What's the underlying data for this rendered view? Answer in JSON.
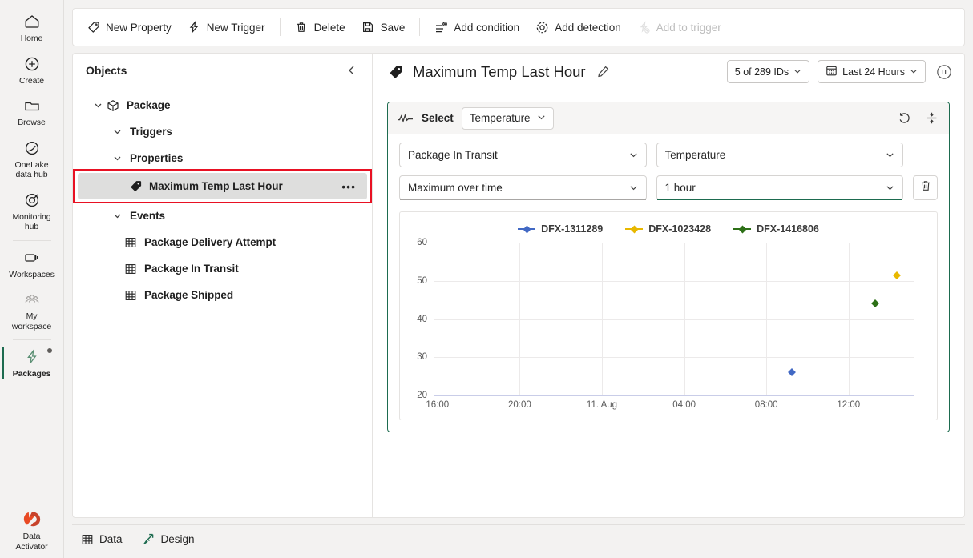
{
  "rail": {
    "items": [
      {
        "label": "Home",
        "icon": "home-icon"
      },
      {
        "label": "Create",
        "icon": "plus-circle-icon"
      },
      {
        "label": "Browse",
        "icon": "folder-icon"
      },
      {
        "label": "OneLake\ndata hub",
        "icon": "onelake-icon"
      },
      {
        "label": "Monitoring\nhub",
        "icon": "monitoring-icon"
      },
      {
        "label": "Workspaces",
        "icon": "workspaces-icon"
      },
      {
        "label": "My\nworkspace",
        "icon": "people-icon"
      },
      {
        "label": "Packages",
        "icon": "activator-bolt-icon"
      }
    ],
    "bottom": {
      "label": "Data\nActivator",
      "icon": "data-activator-logo"
    },
    "accent": "#1d6b4f"
  },
  "toolbar": {
    "items": [
      {
        "label": "New Property",
        "icon": "tag-outline-icon",
        "disabled": false
      },
      {
        "label": "New Trigger",
        "icon": "bolt-outline-icon",
        "disabled": false
      },
      {
        "label": "Delete",
        "icon": "trash-icon",
        "disabled": false
      },
      {
        "label": "Save",
        "icon": "save-icon",
        "disabled": false
      },
      {
        "label": "Add condition",
        "icon": "add-condition-icon",
        "disabled": false
      },
      {
        "label": "Add detection",
        "icon": "add-detection-icon",
        "disabled": false
      },
      {
        "label": "Add to trigger",
        "icon": "add-to-trigger-icon",
        "disabled": true
      }
    ]
  },
  "objects": {
    "title": "Objects",
    "collapse_icon": "chevron-left-icon",
    "tree": [
      {
        "label": "Package",
        "icon": "package-cube-icon",
        "indent": 0,
        "chevron": true,
        "selected": false,
        "highlighted": false
      },
      {
        "label": "Triggers",
        "icon": "",
        "indent": 1,
        "chevron": true,
        "selected": false,
        "highlighted": false
      },
      {
        "label": "Properties",
        "icon": "",
        "indent": 1,
        "chevron": true,
        "selected": false,
        "highlighted": false
      },
      {
        "label": "Maximum Temp Last Hour",
        "icon": "tag-filled-icon",
        "indent": 2,
        "chevron": false,
        "selected": true,
        "highlighted": true,
        "overflow": "•••"
      },
      {
        "label": "Events",
        "icon": "",
        "indent": 1,
        "chevron": true,
        "selected": false,
        "highlighted": false
      },
      {
        "label": "Package Delivery Attempt",
        "icon": "table-icon",
        "indent": 2,
        "chevron": false,
        "selected": false,
        "highlighted": false
      },
      {
        "label": "Package In Transit",
        "icon": "table-icon",
        "indent": 2,
        "chevron": false,
        "selected": false,
        "highlighted": false
      },
      {
        "label": "Package Shipped",
        "icon": "table-icon",
        "indent": 2,
        "chevron": false,
        "selected": false,
        "highlighted": false
      }
    ],
    "highlight_color": "#e81123"
  },
  "detail": {
    "icon": "tag-filled-icon",
    "title": "Maximum Temp Last Hour",
    "edit_icon": "pencil-icon",
    "ids_pill": {
      "label": "5 of 289 IDs",
      "chevron": "chevron-down-icon"
    },
    "time_pill": {
      "label": "Last 24 Hours",
      "icon": "calendar-icon",
      "chevron": "chevron-down-icon"
    },
    "pause_icon": "pause-circle-icon"
  },
  "query": {
    "spark_icon": "sparkline-icon",
    "select_label": "Select",
    "select_value": "Temperature",
    "refresh_icon": "undo-arrow-icon",
    "collapse_icon": "collapse-vertical-icon",
    "fields": [
      {
        "value": "Package In Transit",
        "underline": "none"
      },
      {
        "value": "Temperature",
        "underline": "none"
      },
      {
        "value": "Maximum over time",
        "underline": "grey"
      },
      {
        "value": "1 hour",
        "underline": "green"
      }
    ],
    "delete_icon": "trash-icon"
  },
  "chart_data": {
    "type": "scatter",
    "title": "",
    "xlabel": "",
    "ylabel": "",
    "ylim": [
      20,
      60
    ],
    "yticks": [
      20,
      30,
      40,
      50,
      60
    ],
    "xticks": [
      "16:00",
      "20:00",
      "11. Aug",
      "04:00",
      "08:00",
      "12:00"
    ],
    "grid": true,
    "legend_position": "top-center",
    "series": [
      {
        "name": "DFX-1311289",
        "color": "#4269c4",
        "points": [
          {
            "x": "10:00",
            "x_frac": 0.745,
            "y": 26
          }
        ]
      },
      {
        "name": "DFX-1023428",
        "color": "#e8b800",
        "points": [
          {
            "x": "13:45",
            "x_frac": 0.963,
            "y": 51.5
          }
        ]
      },
      {
        "name": "DFX-1416806",
        "color": "#2d7017",
        "points": [
          {
            "x": "12:45",
            "x_frac": 0.918,
            "y": 44
          }
        ]
      }
    ]
  },
  "bottombar": {
    "items": [
      {
        "label": "Data",
        "icon": "table-icon",
        "color": "#242424"
      },
      {
        "label": "Design",
        "icon": "design-pencil-icon",
        "color": "#1d6b4f"
      }
    ]
  }
}
